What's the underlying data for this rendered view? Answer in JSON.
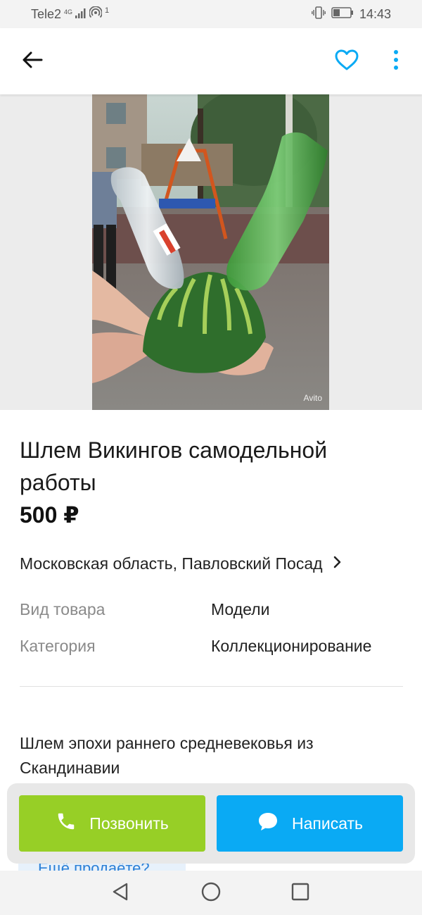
{
  "status_bar": {
    "carrier": "Tele2",
    "network": "4G",
    "hotspot_count": "1",
    "time": "14:43",
    "icons": [
      "signal-icon",
      "hotspot-icon",
      "vibrate-icon",
      "battery-icon"
    ]
  },
  "app_bar": {
    "icons": [
      "back-arrow-icon",
      "heart-icon",
      "more-vertical-icon"
    ],
    "accent_color": "#0aaaf4"
  },
  "gallery": {
    "watermark": "Avito"
  },
  "listing": {
    "title": "Шлем Викингов самодельной работы",
    "price": "500 ₽",
    "location": "Московская область, Павловский Посад",
    "specs": [
      {
        "label": "Вид товара",
        "value": "Модели"
      },
      {
        "label": "Категория",
        "value": "Коллекционирование"
      }
    ],
    "description": "Шлем эпохи раннего средневековья из Скандинавии"
  },
  "peek_banner": {
    "text": "Ещё продаёте?"
  },
  "actions": {
    "call_label": "Позвонить",
    "message_label": "Написать",
    "call_color": "#97cf26",
    "message_color": "#0aaaf4"
  },
  "nav_bar": {
    "icons": [
      "nav-back-icon",
      "nav-home-icon",
      "nav-recents-icon"
    ]
  }
}
